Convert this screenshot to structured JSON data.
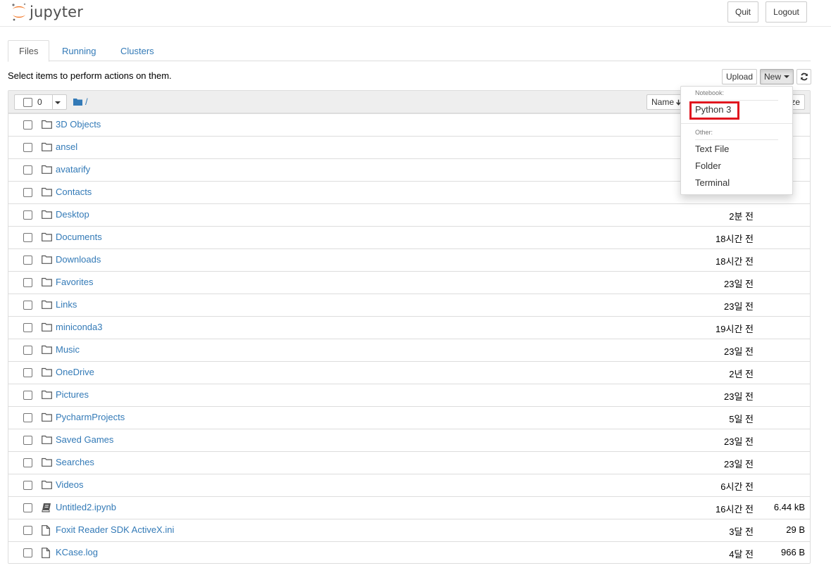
{
  "header": {
    "logo_text": "jupyter",
    "quit_label": "Quit",
    "logout_label": "Logout"
  },
  "tabs": [
    {
      "label": "Files"
    },
    {
      "label": "Running"
    },
    {
      "label": "Clusters"
    }
  ],
  "toolbar": {
    "hint": "Select items to perform actions on them.",
    "upload_label": "Upload",
    "new_label": "New",
    "refresh_icon": "refresh-icon"
  },
  "list_header": {
    "selected_count": "0",
    "path": "/",
    "sort_name_label": "Name",
    "sort_size_label": "ze"
  },
  "new_menu": {
    "notebook_header": "Notebook:",
    "python3": "Python 3",
    "other_header": "Other:",
    "text_file": "Text File",
    "folder": "Folder",
    "terminal": "Terminal"
  },
  "files": [
    {
      "name": "3D Objects",
      "type": "folder",
      "modified": "",
      "size": ""
    },
    {
      "name": "ansel",
      "type": "folder",
      "modified": "",
      "size": ""
    },
    {
      "name": "avatarify",
      "type": "folder",
      "modified": "",
      "size": ""
    },
    {
      "name": "Contacts",
      "type": "folder",
      "modified": "",
      "size": ""
    },
    {
      "name": "Desktop",
      "type": "folder",
      "modified": "2분 전",
      "size": ""
    },
    {
      "name": "Documents",
      "type": "folder",
      "modified": "18시간 전",
      "size": ""
    },
    {
      "name": "Downloads",
      "type": "folder",
      "modified": "18시간 전",
      "size": ""
    },
    {
      "name": "Favorites",
      "type": "folder",
      "modified": "23일 전",
      "size": ""
    },
    {
      "name": "Links",
      "type": "folder",
      "modified": "23일 전",
      "size": ""
    },
    {
      "name": "miniconda3",
      "type": "folder",
      "modified": "19시간 전",
      "size": ""
    },
    {
      "name": "Music",
      "type": "folder",
      "modified": "23일 전",
      "size": ""
    },
    {
      "name": "OneDrive",
      "type": "folder",
      "modified": "2년 전",
      "size": ""
    },
    {
      "name": "Pictures",
      "type": "folder",
      "modified": "23일 전",
      "size": ""
    },
    {
      "name": "PycharmProjects",
      "type": "folder",
      "modified": "5일 전",
      "size": ""
    },
    {
      "name": "Saved Games",
      "type": "folder",
      "modified": "23일 전",
      "size": ""
    },
    {
      "name": "Searches",
      "type": "folder",
      "modified": "23일 전",
      "size": ""
    },
    {
      "name": "Videos",
      "type": "folder",
      "modified": "6시간 전",
      "size": ""
    },
    {
      "name": "Untitled2.ipynb",
      "type": "notebook",
      "modified": "16시간 전",
      "size": "6.44 kB"
    },
    {
      "name": "Foxit Reader SDK ActiveX.ini",
      "type": "file",
      "modified": "3달 전",
      "size": "29 B"
    },
    {
      "name": "KCase.log",
      "type": "file",
      "modified": "4달 전",
      "size": "966 B"
    }
  ]
}
